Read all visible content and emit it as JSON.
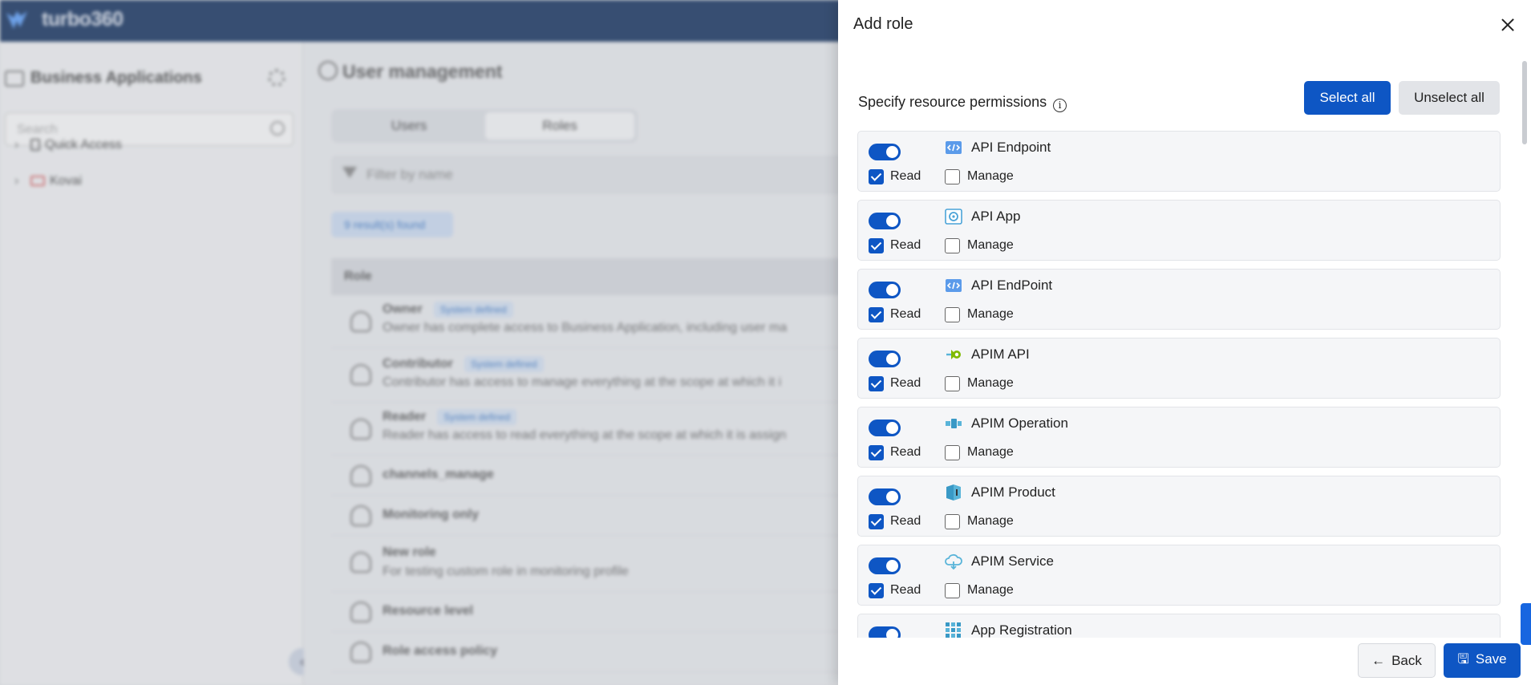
{
  "app": {
    "name": "turbo360"
  },
  "sidebar": {
    "title": "Business Applications",
    "search_placeholder": "Search",
    "tree": [
      "Quick Access",
      "Kovai"
    ]
  },
  "main": {
    "title": "User management",
    "tabs": [
      {
        "label": "Users"
      },
      {
        "label": "Roles"
      }
    ],
    "filter_placeholder": "Filter by name",
    "results_text": "9 result(s) found",
    "column_header": "Role",
    "roles": [
      {
        "name": "Owner",
        "badge": "System defined",
        "description": "Owner has complete access to Business Application, including user ma"
      },
      {
        "name": "Contributor",
        "badge": "System defined",
        "description": "Contributor has access to manage everything at the scope at which it i"
      },
      {
        "name": "Reader",
        "badge": "System defined",
        "description": "Reader has access to read everything at the scope at which it is assign"
      },
      {
        "name": "channels_manage"
      },
      {
        "name": "Monitoring only"
      },
      {
        "name": "New role",
        "description": "For testing custom role in monitoring profile"
      },
      {
        "name": "Resource level"
      },
      {
        "name": "Role access policy"
      }
    ]
  },
  "drawer": {
    "title": "Add role",
    "permissions_heading": "Specify resource permissions",
    "select_all": "Select all",
    "unselect_all": "Unselect all",
    "read_label": "Read",
    "manage_label": "Manage",
    "back_label": "Back",
    "save_label": "Save",
    "resources": [
      {
        "name": "API Endpoint",
        "icon": "api-endpoint-icon",
        "enabled": true,
        "read": true,
        "manage": false
      },
      {
        "name": "API App",
        "icon": "api-app-icon",
        "enabled": true,
        "read": true,
        "manage": false
      },
      {
        "name": "API EndPoint",
        "icon": "api-endpoint-icon",
        "enabled": true,
        "read": true,
        "manage": false
      },
      {
        "name": "APIM API",
        "icon": "apim-api-icon",
        "enabled": true,
        "read": true,
        "manage": false
      },
      {
        "name": "APIM Operation",
        "icon": "apim-operation-icon",
        "enabled": true,
        "read": true,
        "manage": false
      },
      {
        "name": "APIM Product",
        "icon": "apim-product-icon",
        "enabled": true,
        "read": true,
        "manage": false
      },
      {
        "name": "APIM Service",
        "icon": "apim-service-icon",
        "enabled": true,
        "read": true,
        "manage": false
      },
      {
        "name": "App Registration",
        "icon": "app-registration-icon",
        "enabled": true,
        "read": true,
        "manage": false
      }
    ]
  },
  "colors": {
    "primary": "#0e56c4",
    "header": "#0e2d5c",
    "card_bg": "#f5f6f8"
  }
}
